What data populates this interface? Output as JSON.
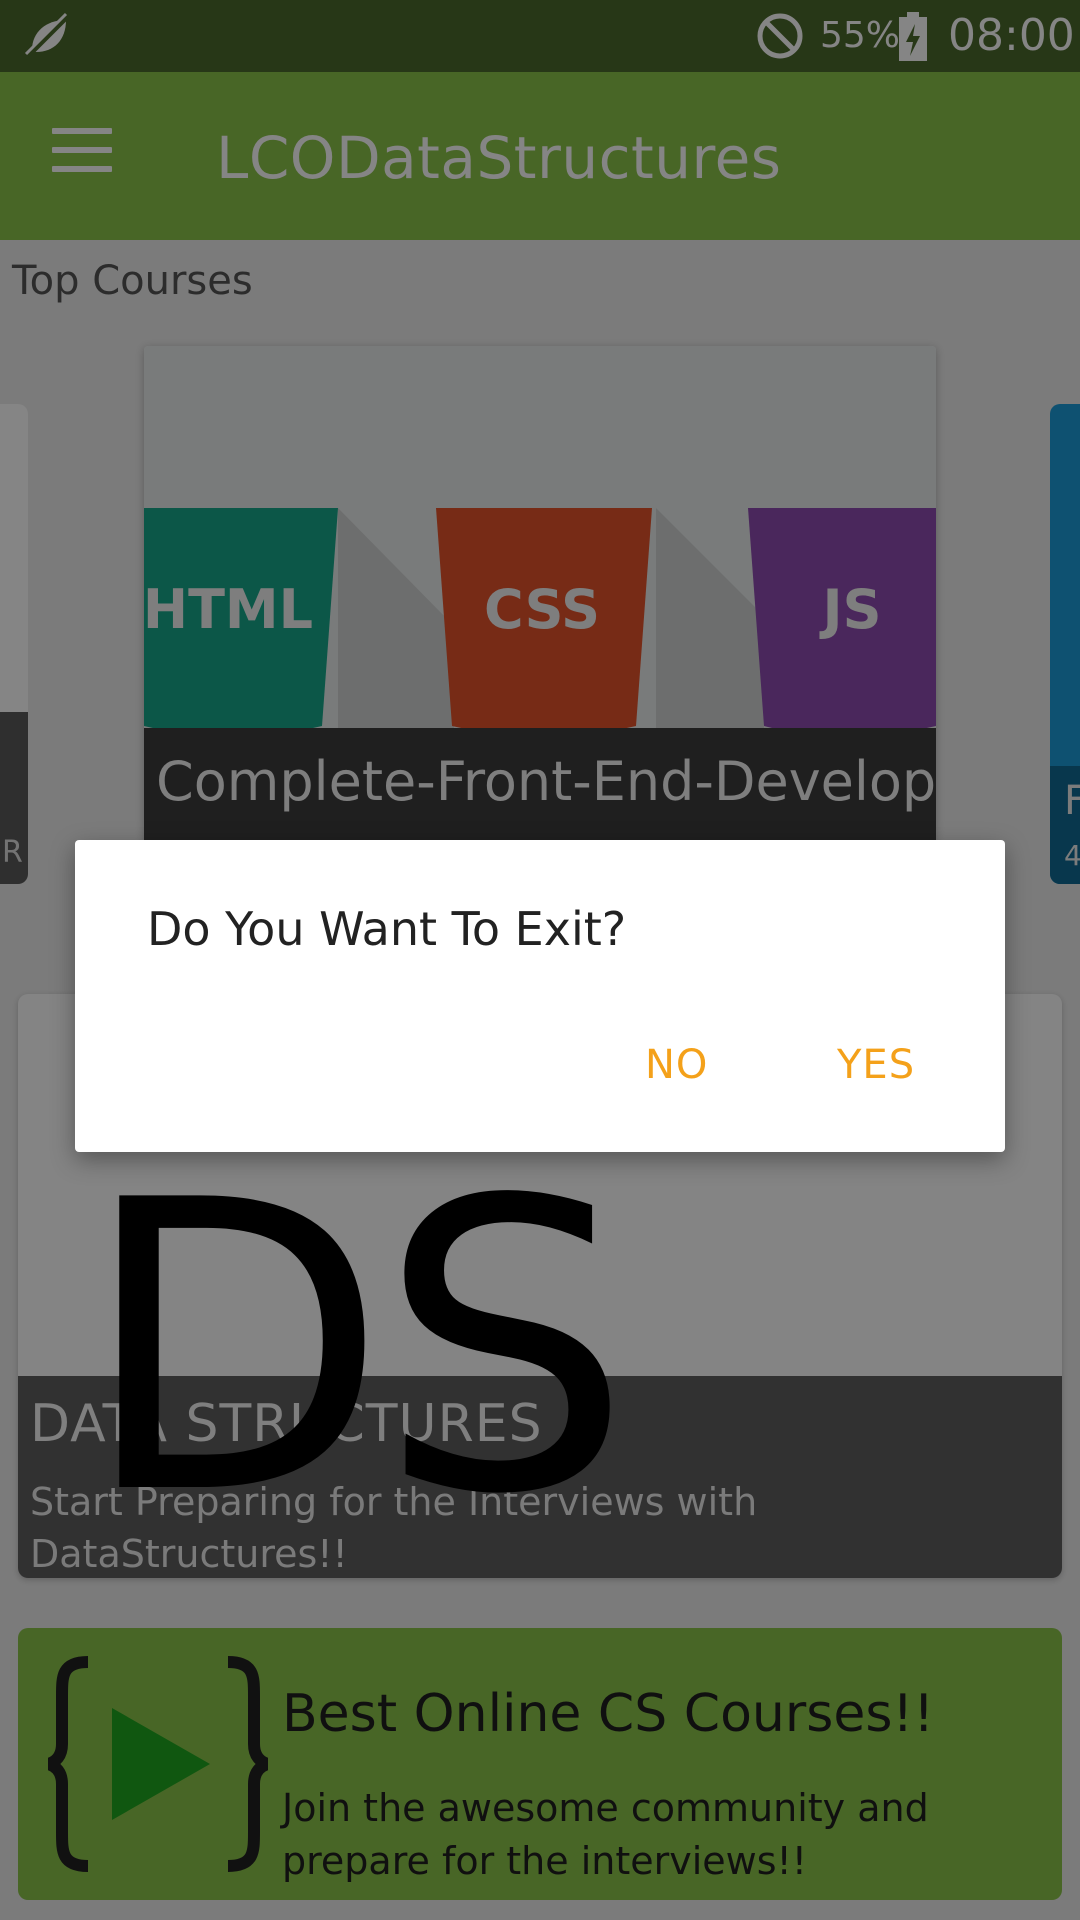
{
  "status_bar": {
    "battery_percent": "55%",
    "time": "08:00"
  },
  "app_bar": {
    "title": "LCODataStructures"
  },
  "main": {
    "section_title": "Top Courses",
    "carousel": {
      "left_partial_text": "R",
      "right_partial_title": "F",
      "right_partial_sub": "4",
      "featured_card": {
        "art_labels": [
          "HTML",
          "CSS",
          "JS"
        ],
        "title": "Complete-Front-End-Development"
      }
    },
    "data_structures_card": {
      "logo_text": "DS",
      "title": "DATA STRUCTURES",
      "subtitle": "Start Preparing for the Interviews with DataStructures!!"
    },
    "promo": {
      "title": "Best Online CS Courses!!",
      "subtitle": "Join the awesome community and prepare for the interviews!!"
    }
  },
  "dialog": {
    "message": "Do You Want To Exit?",
    "negative_label": "NO",
    "positive_label": "YES"
  },
  "colors": {
    "primary": "#8bc34a",
    "status_bar": "#4b6a2c",
    "accent": "#f4a11a"
  }
}
